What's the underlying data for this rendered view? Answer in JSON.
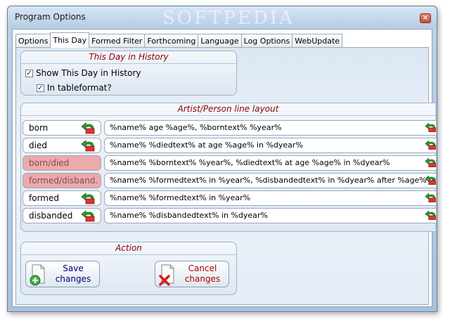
{
  "window": {
    "title": "Program Options",
    "watermark": "SOFTPEDIA",
    "close_glyph": "×"
  },
  "tabs": [
    {
      "label": "Options",
      "active": false
    },
    {
      "label": "This Day",
      "active": true
    },
    {
      "label": "Formed Filter",
      "active": false
    },
    {
      "label": "Forthcoming",
      "active": false
    },
    {
      "label": "Language",
      "active": false
    },
    {
      "label": "Log Options",
      "active": false
    },
    {
      "label": "WebUpdate",
      "active": false
    }
  ],
  "this_day": {
    "title": "This Day in History",
    "show_label": "Show This Day in History",
    "show_checked": true,
    "tableformat_label": "In tableformat?",
    "tableformat_checked": true,
    "check_glyph": "✓"
  },
  "layout": {
    "title": "Artist/Person line layout",
    "rows": [
      {
        "label": "born",
        "format": "%name% age %age%, %borntext% %year%",
        "enabled": true
      },
      {
        "label": "died",
        "format": "%name% %diedtext% at age %age% in %dyear%",
        "enabled": true
      },
      {
        "label": "born/died",
        "format": "%name% %borntext% %year%, %diedtext% at age %age% in %dyear%",
        "enabled": false
      },
      {
        "label": "formed/disband.",
        "format": "%name% %formedtext% in %year%, %disbandedtext% in %dyear% after %age% years",
        "enabled": false
      },
      {
        "label": "formed",
        "format": "%name% %formedtext% in %year%",
        "enabled": true
      },
      {
        "label": "disbanded",
        "format": "%name% %disbandedtext% in %dyear%",
        "enabled": true
      }
    ]
  },
  "action": {
    "title": "Action",
    "save_line1": "Save",
    "save_line2": "changes",
    "cancel_line1": "Cancel",
    "cancel_line2": "changes"
  },
  "colors": {
    "accent_title": "#8b0000",
    "save_text": "#00007a",
    "cancel_text": "#b00000",
    "disabled_row": "#ecaaaa"
  },
  "icons": {
    "undo": "undo-arrow-icon",
    "save": "document-add-icon",
    "cancel": "document-delete-icon"
  }
}
